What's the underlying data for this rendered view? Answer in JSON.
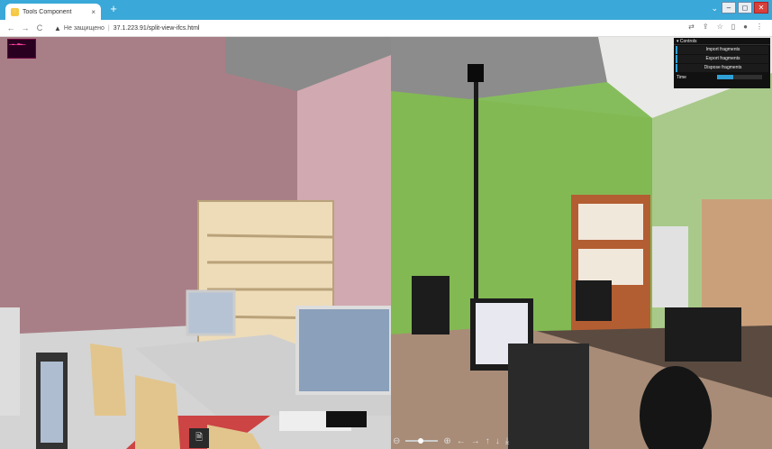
{
  "browser": {
    "tab_title": "Tools Component",
    "tab_close": "×",
    "new_tab": "+",
    "window_controls": {
      "dropdown": "⌄",
      "minimize": "–",
      "maximize": "◻",
      "close": "✕"
    },
    "nav": {
      "back": "←",
      "forward": "→",
      "reload": "C"
    },
    "security_warning": "Не защищено",
    "url": "37.1.223.91/split-view-ifcs.html",
    "toolbar_icons": [
      "translate-icon",
      "share-icon",
      "star-icon",
      "sidebar-icon",
      "profile-icon",
      "menu-icon"
    ]
  },
  "controls": {
    "title": "Controls",
    "buttons": [
      "Import fragments",
      "Export fragments",
      "Dispose fragments"
    ],
    "time_label": "Time",
    "time_value": 0.35
  },
  "bottom_toolbar": {
    "zoom_out": "⊖",
    "zoom_in": "⊕",
    "left": "←",
    "right": "→",
    "up": "↑",
    "down": "↓",
    "download": "⤓",
    "zoom_value": 0.45
  },
  "doc_button": "🗎",
  "colors": {
    "tab_strip": "#3aa8d8",
    "accent": "#2fa1d6",
    "wall_left": "#c39aa2",
    "wall_right": "#86bd5c"
  }
}
